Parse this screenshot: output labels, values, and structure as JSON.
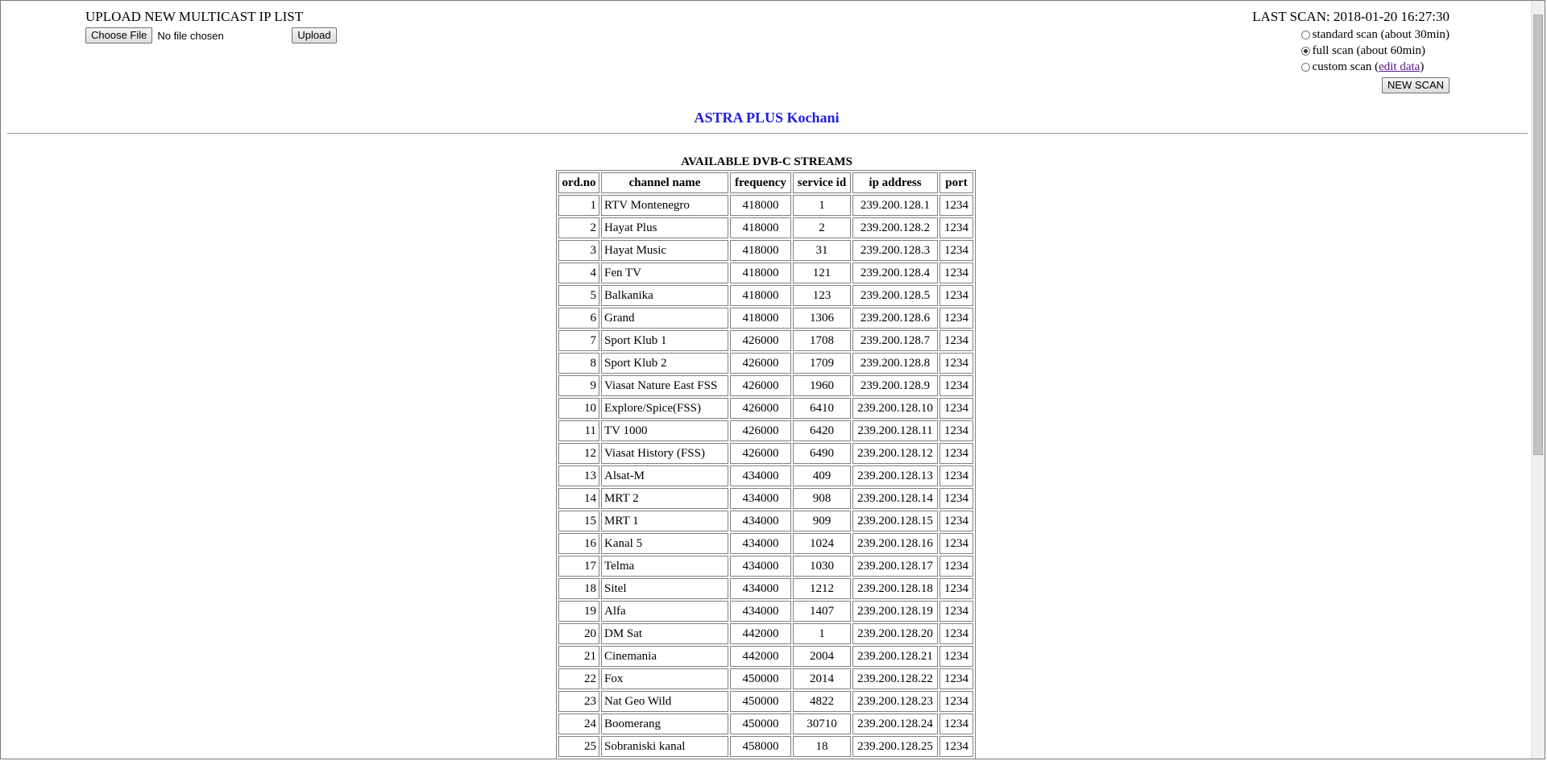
{
  "upload": {
    "title": "UPLOAD NEW MULTICAST IP LIST",
    "choose_file_label": "Choose File",
    "file_status": "No file chosen",
    "upload_label": "Upload"
  },
  "scan": {
    "last_scan_label": "LAST SCAN: 2018-01-20 16:27:30",
    "options": [
      {
        "label": "standard scan (about 30min)",
        "checked": false
      },
      {
        "label": "full scan (about 60min)",
        "checked": true
      },
      {
        "label_prefix": "custom scan (",
        "link_text": "edit data",
        "label_suffix": ")",
        "checked": false
      }
    ],
    "new_scan_label": "NEW SCAN"
  },
  "site_title": "ASTRA PLUS Kochani",
  "table": {
    "title": "AVAILABLE DVB-C STREAMS",
    "headers": [
      "ord.no",
      "channel name",
      "frequency",
      "service id",
      "ip address",
      "port"
    ],
    "rows": [
      [
        "1",
        "RTV Montenegro",
        "418000",
        "1",
        "239.200.128.1",
        "1234"
      ],
      [
        "2",
        "Hayat Plus",
        "418000",
        "2",
        "239.200.128.2",
        "1234"
      ],
      [
        "3",
        "Hayat Music",
        "418000",
        "31",
        "239.200.128.3",
        "1234"
      ],
      [
        "4",
        "Fen TV",
        "418000",
        "121",
        "239.200.128.4",
        "1234"
      ],
      [
        "5",
        "Balkanika",
        "418000",
        "123",
        "239.200.128.5",
        "1234"
      ],
      [
        "6",
        "Grand",
        "418000",
        "1306",
        "239.200.128.6",
        "1234"
      ],
      [
        "7",
        "Sport Klub 1",
        "426000",
        "1708",
        "239.200.128.7",
        "1234"
      ],
      [
        "8",
        "Sport Klub 2",
        "426000",
        "1709",
        "239.200.128.8",
        "1234"
      ],
      [
        "9",
        "Viasat Nature East FSS",
        "426000",
        "1960",
        "239.200.128.9",
        "1234"
      ],
      [
        "10",
        "Explore/Spice(FSS)",
        "426000",
        "6410",
        "239.200.128.10",
        "1234"
      ],
      [
        "11",
        "TV 1000",
        "426000",
        "6420",
        "239.200.128.11",
        "1234"
      ],
      [
        "12",
        "Viasat History (FSS)",
        "426000",
        "6490",
        "239.200.128.12",
        "1234"
      ],
      [
        "13",
        "Alsat-M",
        "434000",
        "409",
        "239.200.128.13",
        "1234"
      ],
      [
        "14",
        "MRT 2",
        "434000",
        "908",
        "239.200.128.14",
        "1234"
      ],
      [
        "15",
        "MRT 1",
        "434000",
        "909",
        "239.200.128.15",
        "1234"
      ],
      [
        "16",
        "Kanal 5",
        "434000",
        "1024",
        "239.200.128.16",
        "1234"
      ],
      [
        "17",
        "Telma",
        "434000",
        "1030",
        "239.200.128.17",
        "1234"
      ],
      [
        "18",
        "Sitel",
        "434000",
        "1212",
        "239.200.128.18",
        "1234"
      ],
      [
        "19",
        "Alfa",
        "434000",
        "1407",
        "239.200.128.19",
        "1234"
      ],
      [
        "20",
        "DM Sat",
        "442000",
        "1",
        "239.200.128.20",
        "1234"
      ],
      [
        "21",
        "Cinemania",
        "442000",
        "2004",
        "239.200.128.21",
        "1234"
      ],
      [
        "22",
        "Fox",
        "450000",
        "2014",
        "239.200.128.22",
        "1234"
      ],
      [
        "23",
        "Nat Geo Wild",
        "450000",
        "4822",
        "239.200.128.23",
        "1234"
      ],
      [
        "24",
        "Boomerang",
        "450000",
        "30710",
        "239.200.128.24",
        "1234"
      ],
      [
        "25",
        "Sobraniski kanal",
        "458000",
        "18",
        "239.200.128.25",
        "1234"
      ]
    ]
  },
  "colors": {
    "title_blue": "#1e1ee6",
    "visited_link": "#551a8b"
  }
}
